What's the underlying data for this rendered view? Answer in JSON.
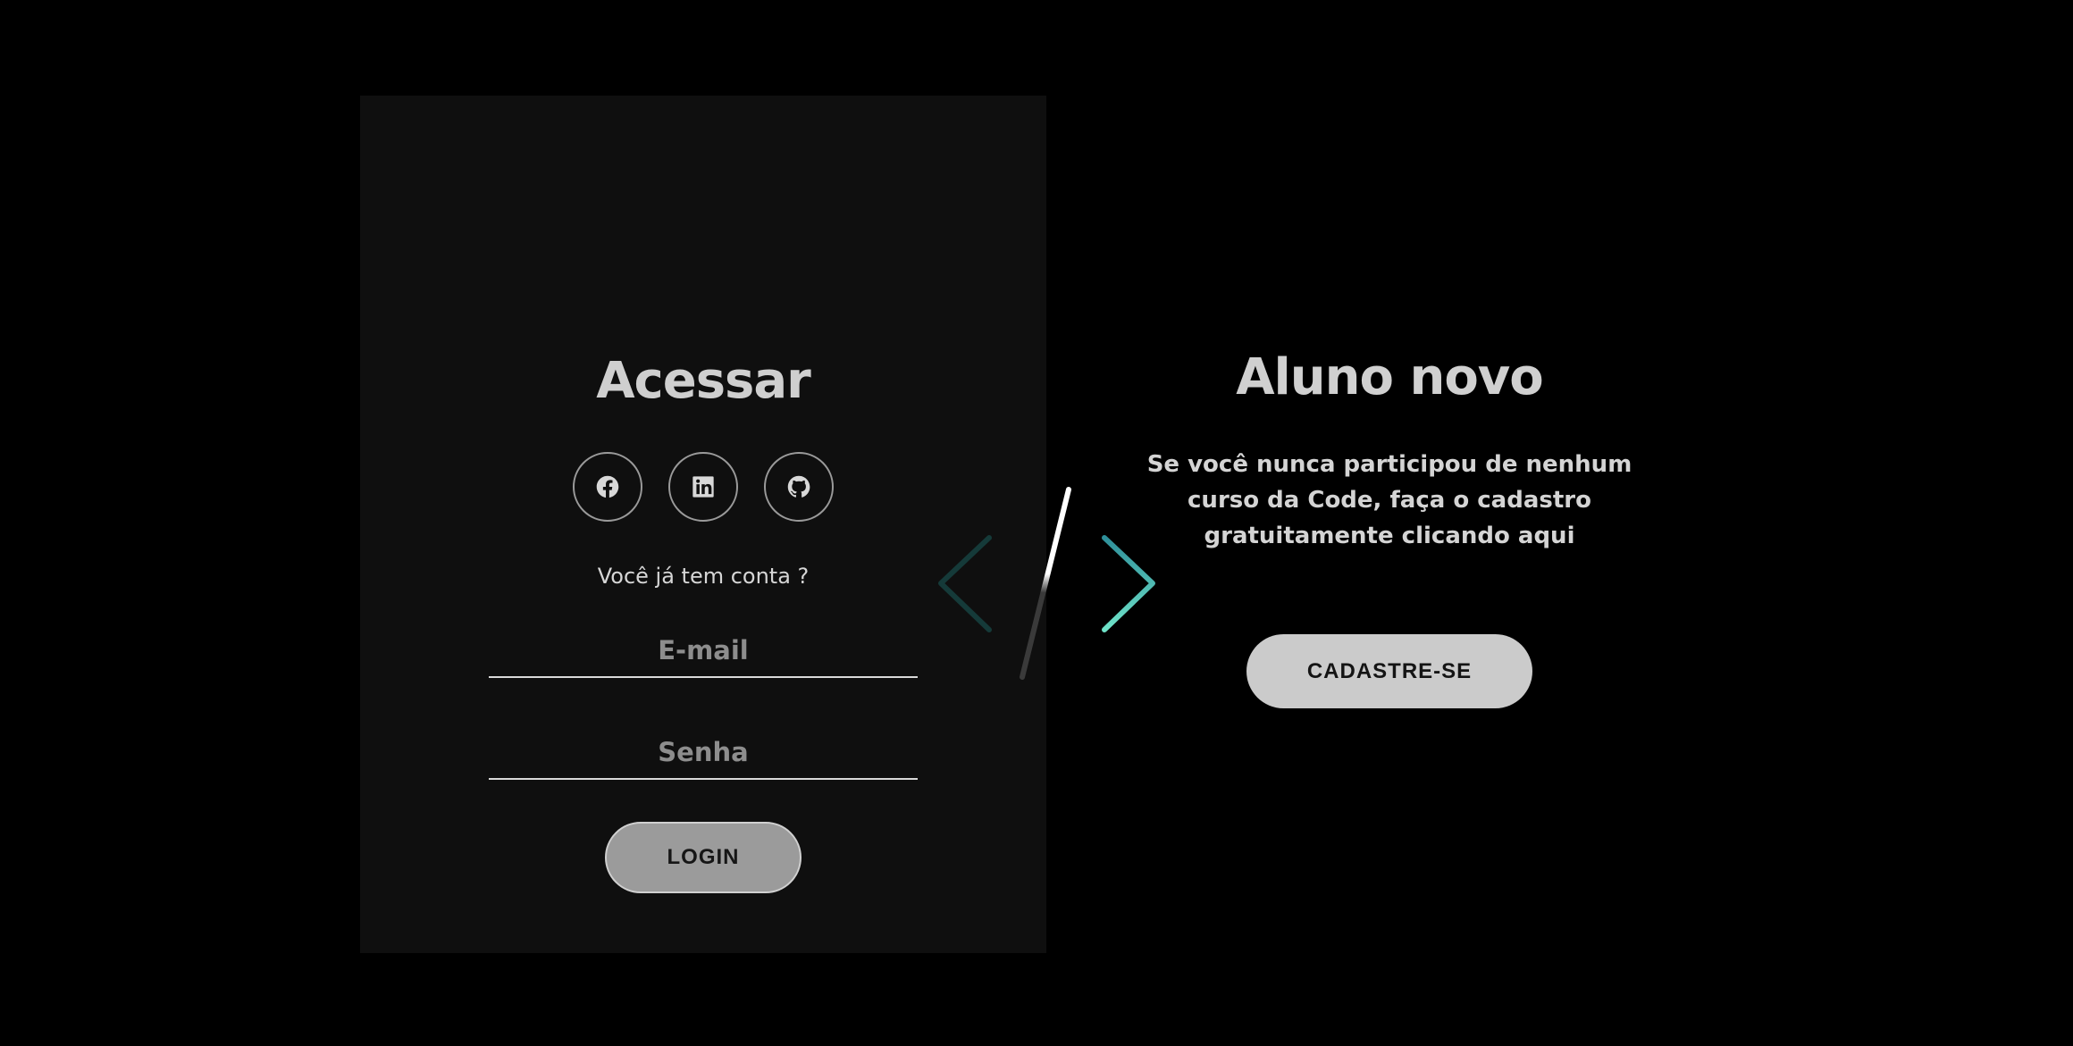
{
  "login": {
    "title": "Acessar",
    "social": [
      {
        "icon": "facebook-icon"
      },
      {
        "icon": "linkedin-icon"
      },
      {
        "icon": "github-icon"
      }
    ],
    "question": "Você já tem conta ?",
    "email_placeholder": "E-mail",
    "password_placeholder": "Senha",
    "button_label": "LOGIN"
  },
  "signup": {
    "title": "Aluno novo",
    "description": "Se você nunca participou de nenhum curso da Code, faça o cadastro gratuitamente clicando aqui",
    "button_label": "CADASTRE-SE"
  },
  "colors": {
    "page_background": "#000000",
    "panel_background": "#0f0f0f",
    "accent_teal": "#3fb8b0",
    "accent_mint": "#6fe3c9",
    "login_button": "#9b9b9b",
    "signup_button": "#cbcbcb"
  },
  "divider_icon": "code-slash-icon"
}
